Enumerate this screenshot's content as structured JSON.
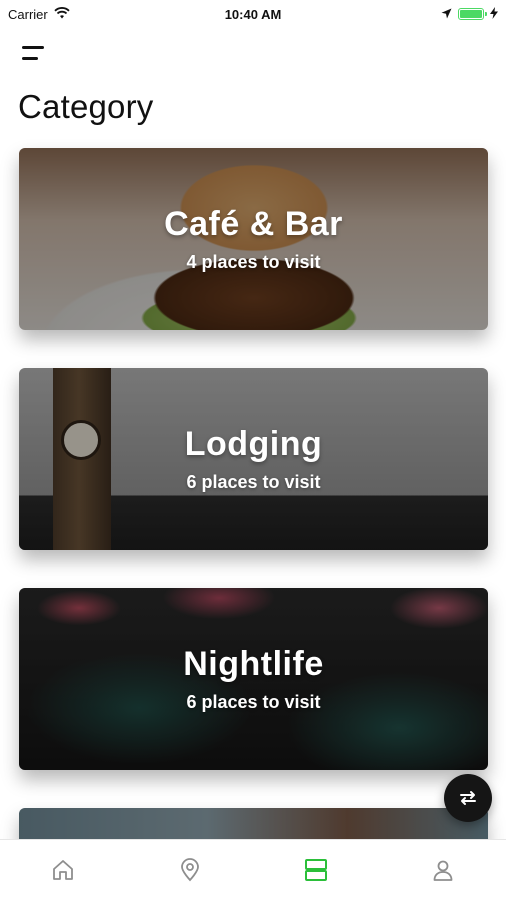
{
  "status_bar": {
    "carrier": "Carrier",
    "time": "10:40 AM",
    "battery_level": 1.0
  },
  "header": {
    "menu_icon": "hamburger-menu-icon",
    "title": "Category"
  },
  "categories": [
    {
      "title": "Café & Bar",
      "subtitle": "4 places to visit"
    },
    {
      "title": "Lodging",
      "subtitle": "6 places to visit"
    },
    {
      "title": "Nightlife",
      "subtitle": "6 places to visit"
    }
  ],
  "fab": {
    "icon": "swap-arrows-icon"
  },
  "tab_bar": {
    "active_color": "#2bbf3a",
    "inactive_color": "#8e8e8e",
    "tabs": [
      {
        "icon": "home-icon",
        "active": false
      },
      {
        "icon": "location-pin-icon",
        "active": false
      },
      {
        "icon": "category-cards-icon",
        "active": true
      },
      {
        "icon": "profile-icon",
        "active": false
      }
    ]
  }
}
